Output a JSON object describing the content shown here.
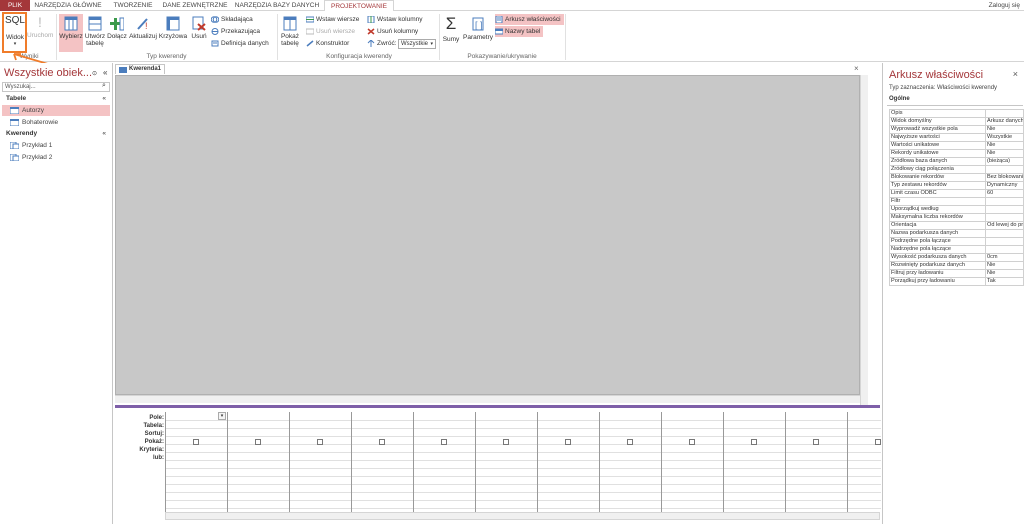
{
  "tabs": [
    {
      "label": "PLIK",
      "key": "file"
    },
    {
      "label": "NARZĘDZIA GŁÓWNE"
    },
    {
      "label": "TWORZENIE"
    },
    {
      "label": "DANE ZEWNĘTRZNE"
    },
    {
      "label": "NARZĘDZIA BAZY DANYCH"
    },
    {
      "label": "PROJEKTOWANIE",
      "active": true
    }
  ],
  "login": "Zaloguj się",
  "ribbon": {
    "wyniki": {
      "sql": "SQL",
      "widok": "Widok",
      "uruchom": "Uruchom",
      "group": "Wyniki"
    },
    "typ": {
      "wybierz": "Wybierz",
      "utworz_1": "Utwórz",
      "utworz_2": "tabelę",
      "dolacz": "Dołącz",
      "aktualizuj": "Aktualizuj",
      "krzyzowa": "Krzyżowa",
      "usun": "Usuń",
      "skladajaca": "Składająca",
      "przekazujaca": "Przekazująca",
      "definicja": "Definicja danych",
      "group": "Typ kwerendy"
    },
    "konf": {
      "pokaz_1": "Pokaż",
      "pokaz_2": "tabelę",
      "wstaw_wiersze": "Wstaw wiersze",
      "usun_wiersze": "Usuń wiersze",
      "konstruktor": "Konstruktor",
      "wstaw_kolumny": "Wstaw kolumny",
      "usun_kolumny": "Usuń kolumny",
      "zwroc": "Zwróć:",
      "zwroc_value": "Wszystkie",
      "group": "Konfiguracja kwerendy"
    },
    "pokaz": {
      "sumy": "Sumy",
      "parametry": "Parametry",
      "arkusz": "Arkusz właściwości",
      "nazwy": "Nazwy tabel",
      "group": "Pokazywanie/ukrywanie"
    }
  },
  "nav": {
    "title": "Wszystkie obiek...",
    "search_placeholder": "Wyszukaj...",
    "sections": [
      {
        "label": "Tabele",
        "items": [
          {
            "label": "Autorzy",
            "selected": true
          },
          {
            "label": "Bohaterowie"
          }
        ]
      },
      {
        "label": "Kwerendy",
        "items": [
          {
            "label": "Przykład 1"
          },
          {
            "label": "Przykład 2"
          }
        ]
      }
    ]
  },
  "doc": {
    "tab": "Kwerenda1"
  },
  "grid": {
    "rows": [
      "Pole:",
      "Tabela:",
      "Sortuj:",
      "Pokaż:",
      "Kryteria:",
      "lub:"
    ],
    "columns": 12
  },
  "props": {
    "title": "Arkusz właściwości",
    "subtitle": "Typ zaznaczenia:  Właściwości kwerendy",
    "tab": "Ogólne",
    "rows": [
      {
        "k": "Opis",
        "v": ""
      },
      {
        "k": "Widok domyślny",
        "v": "Arkusz danych"
      },
      {
        "k": "Wyprowadź wszystkie pola",
        "v": "Nie"
      },
      {
        "k": "Najwyższe wartości",
        "v": "Wszystkie"
      },
      {
        "k": "Wartości unikatowe",
        "v": "Nie"
      },
      {
        "k": "Rekordy unikatowe",
        "v": "Nie"
      },
      {
        "k": "Źródłowa baza danych",
        "v": "(bieżąca)"
      },
      {
        "k": "Źródłowy ciąg połączenia",
        "v": ""
      },
      {
        "k": "Blokowanie rekordów",
        "v": "Bez blokowania"
      },
      {
        "k": "Typ zestawu rekordów",
        "v": "Dynamiczny"
      },
      {
        "k": "Limit czasu ODBC",
        "v": "60"
      },
      {
        "k": "Filtr",
        "v": ""
      },
      {
        "k": "Uporządkuj według",
        "v": ""
      },
      {
        "k": "Maksymalna liczba rekordów",
        "v": ""
      },
      {
        "k": "Orientacja",
        "v": "Od lewej do prawej"
      },
      {
        "k": "Nazwa podarkusza danych",
        "v": ""
      },
      {
        "k": "Podrzędne pola łączące",
        "v": ""
      },
      {
        "k": "Nadrzędne pola łączące",
        "v": ""
      },
      {
        "k": "Wysokość podarkusza danych",
        "v": "0cm"
      },
      {
        "k": "Rozwinięty podarkusz danych",
        "v": "Nie"
      },
      {
        "k": "Filtruj przy ładowaniu",
        "v": "Nie"
      },
      {
        "k": "Porządkuj przy ładowaniu",
        "v": "Tak"
      }
    ]
  },
  "colors": {
    "accent": "#a4373a",
    "selected": "#f4c3c4",
    "highlight": "#f07c2a"
  }
}
